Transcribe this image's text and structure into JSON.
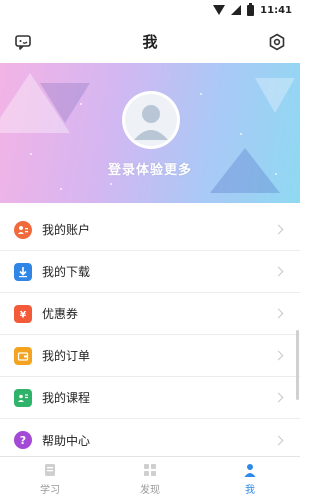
{
  "statusbar": {
    "time": "11:41"
  },
  "header": {
    "title": "我",
    "message_icon": "message-icon",
    "settings_icon": "settings-icon"
  },
  "banner": {
    "login_text": "登录体验更多",
    "avatar_icon": "avatar-placeholder-icon"
  },
  "menu": {
    "items": [
      {
        "label": "我的账户",
        "icon": "account-icon",
        "color": "#f06a3b"
      },
      {
        "label": "我的下载",
        "icon": "download-icon",
        "color": "#2f86e6"
      },
      {
        "label": "优惠券",
        "icon": "coupon-icon",
        "color": "#f35a3a"
      },
      {
        "label": "我的订单",
        "icon": "wallet-icon",
        "color": "#f3a31f"
      },
      {
        "label": "我的课程",
        "icon": "course-icon",
        "color": "#2fb36a"
      },
      {
        "label": "帮助中心",
        "icon": "help-icon",
        "color": "#a24ad6"
      }
    ]
  },
  "bottom_nav": {
    "tabs": [
      {
        "label": "学习",
        "icon": "study-icon",
        "active": false
      },
      {
        "label": "发现",
        "icon": "discover-icon",
        "active": false
      },
      {
        "label": "我",
        "icon": "me-icon",
        "active": true
      }
    ]
  },
  "colors": {
    "accent": "#2f89e8",
    "inactive": "#9a9a9a"
  }
}
